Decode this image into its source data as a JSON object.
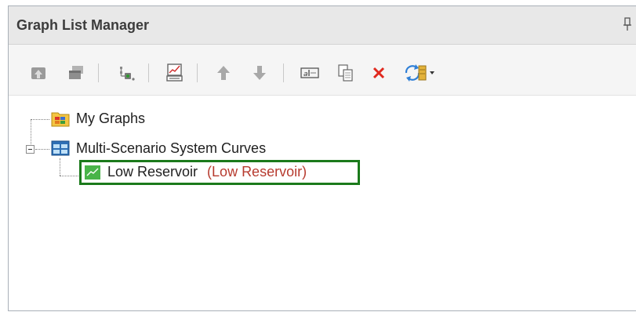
{
  "panel": {
    "title": "Graph List Manager"
  },
  "toolbar": {
    "buttons": [
      {
        "icon": "upload-icon",
        "enabled": false
      },
      {
        "icon": "stack-windows-icon",
        "enabled": false
      },
      {
        "icon": "graph-settings-icon",
        "enabled": false
      },
      {
        "icon": "graph-report-icon",
        "enabled": false
      },
      {
        "icon": "move-up-arrow-icon",
        "enabled": false
      },
      {
        "icon": "move-down-arrow-icon",
        "enabled": false
      },
      {
        "icon": "rename-icon",
        "enabled": true
      },
      {
        "icon": "copy-icon",
        "enabled": true
      },
      {
        "icon": "delete-x-icon",
        "enabled": true
      },
      {
        "icon": "refresh-dropdown-icon",
        "enabled": true
      }
    ]
  },
  "tree": {
    "my_graphs": "My Graphs",
    "folder": "Multi-Scenario System Curves",
    "item": {
      "label": "Low Reservoir",
      "scenario": "(Low Reservoir)"
    }
  },
  "colors": {
    "selection_border": "#1b7a1b",
    "scenario_text": "#b73b2f",
    "delete_red": "#e0291e"
  }
}
